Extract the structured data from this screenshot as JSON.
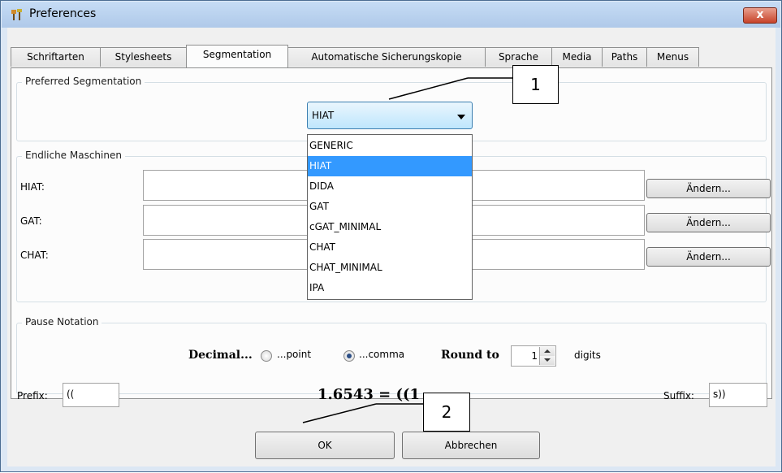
{
  "window": {
    "title": "Preferences",
    "close_label": "x"
  },
  "tabs": [
    {
      "label": "Schriftarten",
      "active": false
    },
    {
      "label": "Stylesheets",
      "active": false
    },
    {
      "label": "Segmentation",
      "active": true
    },
    {
      "label": "Automatische Sicherungskopie",
      "active": false
    },
    {
      "label": "Sprache",
      "active": false
    },
    {
      "label": "Media",
      "active": false
    },
    {
      "label": "Paths",
      "active": false
    },
    {
      "label": "Menus",
      "active": false
    }
  ],
  "preferred_segmentation": {
    "legend": "Preferred Segmentation",
    "selected": "HIAT",
    "options": [
      "GENERIC",
      "HIAT",
      "DIDA",
      "GAT",
      "cGAT_MINIMAL",
      "CHAT",
      "CHAT_MINIMAL",
      "IPA"
    ]
  },
  "endliche_maschinen": {
    "legend": "Endliche Maschinen",
    "rows": [
      {
        "label": "HIAT:",
        "value": "",
        "button": "Ändern..."
      },
      {
        "label": "GAT:",
        "value": "",
        "button": "Ändern..."
      },
      {
        "label": "CHAT:",
        "value": "",
        "button": "Ändern..."
      }
    ]
  },
  "pause_notation": {
    "legend": "Pause Notation",
    "decimal_label": "Decimal...",
    "point_label": "...point",
    "comma_label": "...comma",
    "selected": "comma",
    "round_to_label": "Round to",
    "round_to_value": "1",
    "digits_label": "digits",
    "prefix_label": "Prefix:",
    "prefix_value": "((",
    "suffix_label": "Suffix:",
    "suffix_value": "s))",
    "example": "1.6543 = ((1"
  },
  "footer": {
    "ok_label": "OK",
    "cancel_label": "Abbrechen"
  },
  "callouts": [
    "1",
    "2"
  ]
}
